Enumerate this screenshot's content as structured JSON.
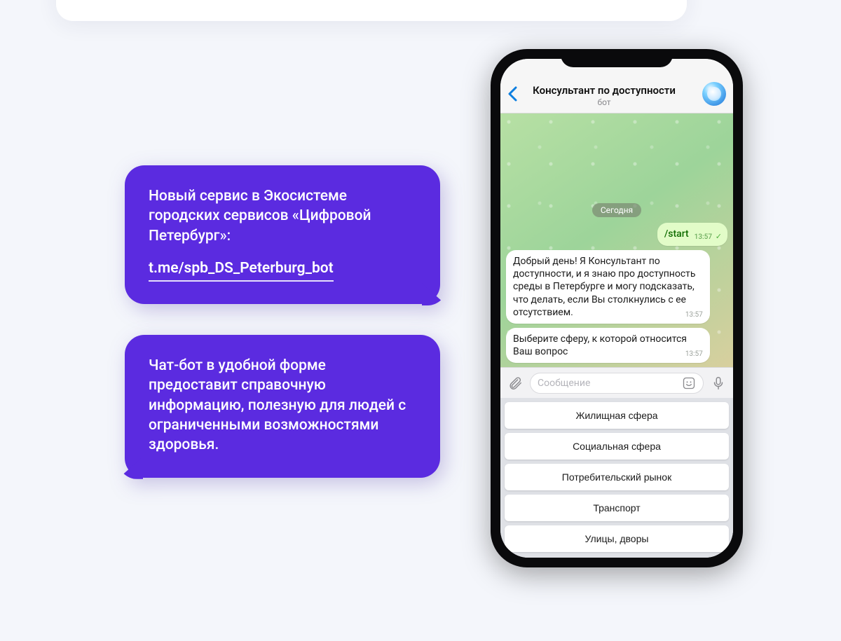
{
  "callouts": {
    "first": {
      "text": "Новый сервис в Экосистеме городских сервисов «Цифровой Петербург»:",
      "link": "t.me/spb_DS_Peterburg_bot"
    },
    "second": {
      "text": "Чат-бот в удобной форме предоставит справочную информацию, полезную для людей с ограниченными возможностями здоровья."
    }
  },
  "telegram": {
    "header": {
      "title": "Консультант по доступности",
      "subtitle": "бот"
    },
    "date_label": "Сегодня",
    "messages": {
      "start": {
        "text": "/start",
        "time": "13:57"
      },
      "greeting": {
        "text": "Добрый день! Я Консультант по доступности, и я знаю про доступность среды в Петербурге и могу подсказать, что делать, если Вы столкнулись с ее отсутствием.",
        "time": "13:57"
      },
      "prompt": {
        "text": "Выберите сферу, к которой относится Ваш вопрос",
        "time": "13:57"
      }
    },
    "input_placeholder": "Сообщение",
    "options": [
      "Жилищная сфера",
      "Социальная сфера",
      "Потребительский рынок",
      "Транспорт",
      "Улицы, дворы"
    ]
  }
}
